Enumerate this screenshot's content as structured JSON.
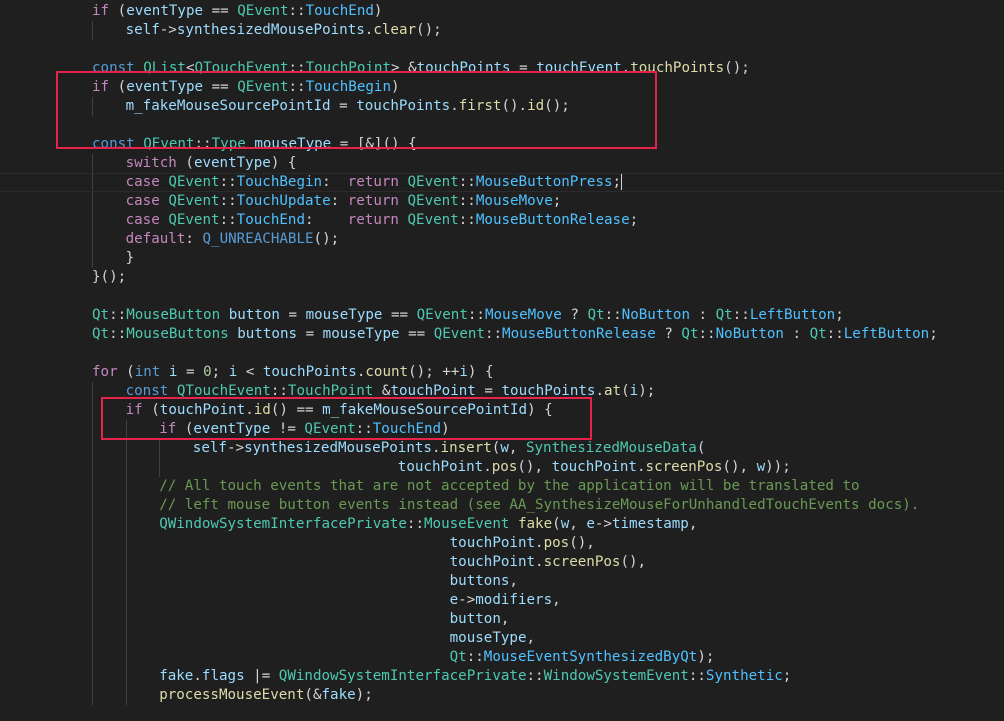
{
  "editor": {
    "lines": [
      {
        "indent": 0,
        "tokens": [
          [
            "kw",
            "if"
          ],
          [
            "op",
            " ("
          ],
          [
            "var",
            "eventType"
          ],
          [
            "op",
            " == "
          ],
          [
            "ns",
            "QEvent"
          ],
          [
            "op",
            "::"
          ],
          [
            "enum",
            "TouchEnd"
          ],
          [
            "op",
            ")"
          ]
        ]
      },
      {
        "indent": 1,
        "tokens": [
          [
            "var",
            "self"
          ],
          [
            "op",
            "->"
          ],
          [
            "var",
            "synthesizedMousePoints"
          ],
          [
            "op",
            "."
          ],
          [
            "func",
            "clear"
          ],
          [
            "op",
            "();"
          ]
        ]
      },
      {
        "indent": 0,
        "tokens": []
      },
      {
        "indent": 0,
        "tokens": [
          [
            "type",
            "const"
          ],
          [
            "op",
            " "
          ],
          [
            "ns",
            "QList"
          ],
          [
            "op",
            "<"
          ],
          [
            "ns",
            "QTouchEvent"
          ],
          [
            "op",
            "::"
          ],
          [
            "ns",
            "TouchPoint"
          ],
          [
            "op",
            "> &"
          ],
          [
            "var",
            "touchPoints"
          ],
          [
            "op",
            " = "
          ],
          [
            "var",
            "touchEvent"
          ],
          [
            "op",
            "."
          ],
          [
            "func",
            "touchPoints"
          ],
          [
            "op",
            "();"
          ]
        ]
      },
      {
        "indent": 0,
        "tokens": [
          [
            "kw",
            "if"
          ],
          [
            "op",
            " ("
          ],
          [
            "var",
            "eventType"
          ],
          [
            "op",
            " == "
          ],
          [
            "ns",
            "QEvent"
          ],
          [
            "op",
            "::"
          ],
          [
            "enum",
            "TouchBegin"
          ],
          [
            "op",
            ")"
          ]
        ]
      },
      {
        "indent": 1,
        "tokens": [
          [
            "var",
            "m_fakeMouseSourcePointId"
          ],
          [
            "op",
            " = "
          ],
          [
            "var",
            "touchPoints"
          ],
          [
            "op",
            "."
          ],
          [
            "func",
            "first"
          ],
          [
            "op",
            "()."
          ],
          [
            "func",
            "id"
          ],
          [
            "op",
            "();"
          ]
        ]
      },
      {
        "indent": 0,
        "tokens": []
      },
      {
        "indent": 0,
        "tokens": [
          [
            "type",
            "const"
          ],
          [
            "op",
            " "
          ],
          [
            "ns",
            "QEvent"
          ],
          [
            "op",
            "::"
          ],
          [
            "ns",
            "Type"
          ],
          [
            "op",
            " "
          ],
          [
            "var",
            "mouseType"
          ],
          [
            "op",
            " = [&]() {"
          ]
        ]
      },
      {
        "indent": 1,
        "tokens": [
          [
            "kw",
            "switch"
          ],
          [
            "op",
            " ("
          ],
          [
            "var",
            "eventType"
          ],
          [
            "op",
            ") {"
          ]
        ]
      },
      {
        "indent": 1,
        "current": true,
        "cursor": true,
        "tokens": [
          [
            "kw",
            "case"
          ],
          [
            "op",
            " "
          ],
          [
            "ns",
            "QEvent"
          ],
          [
            "op",
            "::"
          ],
          [
            "enum",
            "TouchBegin"
          ],
          [
            "op",
            ":  "
          ],
          [
            "kw",
            "return"
          ],
          [
            "op",
            " "
          ],
          [
            "ns",
            "QEvent"
          ],
          [
            "op",
            "::"
          ],
          [
            "enum",
            "MouseButtonPress"
          ],
          [
            "op",
            ";"
          ]
        ]
      },
      {
        "indent": 1,
        "tokens": [
          [
            "kw",
            "case"
          ],
          [
            "op",
            " "
          ],
          [
            "ns",
            "QEvent"
          ],
          [
            "op",
            "::"
          ],
          [
            "enum",
            "TouchUpdate"
          ],
          [
            "op",
            ": "
          ],
          [
            "kw",
            "return"
          ],
          [
            "op",
            " "
          ],
          [
            "ns",
            "QEvent"
          ],
          [
            "op",
            "::"
          ],
          [
            "enum",
            "MouseMove"
          ],
          [
            "op",
            ";"
          ]
        ]
      },
      {
        "indent": 1,
        "tokens": [
          [
            "kw",
            "case"
          ],
          [
            "op",
            " "
          ],
          [
            "ns",
            "QEvent"
          ],
          [
            "op",
            "::"
          ],
          [
            "enum",
            "TouchEnd"
          ],
          [
            "op",
            ":    "
          ],
          [
            "kw",
            "return"
          ],
          [
            "op",
            " "
          ],
          [
            "ns",
            "QEvent"
          ],
          [
            "op",
            "::"
          ],
          [
            "enum",
            "MouseButtonRelease"
          ],
          [
            "op",
            ";"
          ]
        ]
      },
      {
        "indent": 1,
        "tokens": [
          [
            "kw",
            "default"
          ],
          [
            "op",
            ": "
          ],
          [
            "macro",
            "Q_UNREACHABLE"
          ],
          [
            "op",
            "();"
          ]
        ]
      },
      {
        "indent": 1,
        "tokens": [
          [
            "op",
            "}"
          ]
        ]
      },
      {
        "indent": 0,
        "tokens": [
          [
            "op",
            "}();"
          ]
        ]
      },
      {
        "indent": 0,
        "tokens": []
      },
      {
        "indent": 0,
        "tokens": [
          [
            "ns",
            "Qt"
          ],
          [
            "op",
            "::"
          ],
          [
            "ns",
            "MouseButton"
          ],
          [
            "op",
            " "
          ],
          [
            "var",
            "button"
          ],
          [
            "op",
            " = "
          ],
          [
            "var",
            "mouseType"
          ],
          [
            "op",
            " == "
          ],
          [
            "ns",
            "QEvent"
          ],
          [
            "op",
            "::"
          ],
          [
            "enum",
            "MouseMove"
          ],
          [
            "op",
            " ? "
          ],
          [
            "ns",
            "Qt"
          ],
          [
            "op",
            "::"
          ],
          [
            "enum",
            "NoButton"
          ],
          [
            "op",
            " : "
          ],
          [
            "ns",
            "Qt"
          ],
          [
            "op",
            "::"
          ],
          [
            "enum",
            "LeftButton"
          ],
          [
            "op",
            ";"
          ]
        ]
      },
      {
        "indent": 0,
        "tokens": [
          [
            "ns",
            "Qt"
          ],
          [
            "op",
            "::"
          ],
          [
            "ns",
            "MouseButtons"
          ],
          [
            "op",
            " "
          ],
          [
            "var",
            "buttons"
          ],
          [
            "op",
            " = "
          ],
          [
            "var",
            "mouseType"
          ],
          [
            "op",
            " == "
          ],
          [
            "ns",
            "QEvent"
          ],
          [
            "op",
            "::"
          ],
          [
            "enum",
            "MouseButtonRelease"
          ],
          [
            "op",
            " ? "
          ],
          [
            "ns",
            "Qt"
          ],
          [
            "op",
            "::"
          ],
          [
            "enum",
            "NoButton"
          ],
          [
            "op",
            " : "
          ],
          [
            "ns",
            "Qt"
          ],
          [
            "op",
            "::"
          ],
          [
            "enum",
            "LeftButton"
          ],
          [
            "op",
            ";"
          ]
        ]
      },
      {
        "indent": 0,
        "tokens": []
      },
      {
        "indent": 0,
        "tokens": [
          [
            "kw",
            "for"
          ],
          [
            "op",
            " ("
          ],
          [
            "type",
            "int"
          ],
          [
            "op",
            " "
          ],
          [
            "var",
            "i"
          ],
          [
            "op",
            " = "
          ],
          [
            "num",
            "0"
          ],
          [
            "op",
            "; "
          ],
          [
            "var",
            "i"
          ],
          [
            "op",
            " < "
          ],
          [
            "var",
            "touchPoints"
          ],
          [
            "op",
            "."
          ],
          [
            "func",
            "count"
          ],
          [
            "op",
            "(); ++"
          ],
          [
            "var",
            "i"
          ],
          [
            "op",
            ") {"
          ]
        ]
      },
      {
        "indent": 1,
        "tokens": [
          [
            "type",
            "const"
          ],
          [
            "op",
            " "
          ],
          [
            "ns",
            "QTouchEvent"
          ],
          [
            "op",
            "::"
          ],
          [
            "ns",
            "TouchPoint"
          ],
          [
            "op",
            " &"
          ],
          [
            "var",
            "touchPoint"
          ],
          [
            "op",
            " = "
          ],
          [
            "var",
            "touchPoints"
          ],
          [
            "op",
            "."
          ],
          [
            "func",
            "at"
          ],
          [
            "op",
            "("
          ],
          [
            "var",
            "i"
          ],
          [
            "op",
            ");"
          ]
        ]
      },
      {
        "indent": 1,
        "tokens": [
          [
            "kw",
            "if"
          ],
          [
            "op",
            " ("
          ],
          [
            "var",
            "touchPoint"
          ],
          [
            "op",
            "."
          ],
          [
            "func",
            "id"
          ],
          [
            "op",
            "() == "
          ],
          [
            "var",
            "m_fakeMouseSourcePointId"
          ],
          [
            "op",
            ") {"
          ]
        ]
      },
      {
        "indent": 2,
        "tokens": [
          [
            "kw",
            "if"
          ],
          [
            "op",
            " ("
          ],
          [
            "var",
            "eventType"
          ],
          [
            "op",
            " != "
          ],
          [
            "ns",
            "QEvent"
          ],
          [
            "op",
            "::"
          ],
          [
            "enum",
            "TouchEnd"
          ],
          [
            "op",
            ")"
          ]
        ]
      },
      {
        "indent": 3,
        "tokens": [
          [
            "var",
            "self"
          ],
          [
            "op",
            "->"
          ],
          [
            "var",
            "synthesizedMousePoints"
          ],
          [
            "op",
            "."
          ],
          [
            "func",
            "insert"
          ],
          [
            "op",
            "("
          ],
          [
            "var",
            "w"
          ],
          [
            "op",
            ", "
          ],
          [
            "ns",
            "SynthesizedMouseData"
          ],
          [
            "op",
            "("
          ]
        ]
      },
      {
        "indent": 3,
        "pad": "                        ",
        "tokens": [
          [
            "var",
            "touchPoint"
          ],
          [
            "op",
            "."
          ],
          [
            "func",
            "pos"
          ],
          [
            "op",
            "(), "
          ],
          [
            "var",
            "touchPoint"
          ],
          [
            "op",
            "."
          ],
          [
            "func",
            "screenPos"
          ],
          [
            "op",
            "(), "
          ],
          [
            "var",
            "w"
          ],
          [
            "op",
            "));"
          ]
        ]
      },
      {
        "indent": 2,
        "tokens": [
          [
            "com",
            "// All touch events that are not accepted by the application will be translated to"
          ]
        ]
      },
      {
        "indent": 2,
        "tokens": [
          [
            "com",
            "// left mouse button events instead (see AA_SynthesizeMouseForUnhandledTouchEvents docs)."
          ]
        ]
      },
      {
        "indent": 2,
        "tokens": [
          [
            "ns",
            "QWindowSystemInterfacePrivate"
          ],
          [
            "op",
            "::"
          ],
          [
            "ns",
            "MouseEvent"
          ],
          [
            "op",
            " "
          ],
          [
            "func",
            "fake"
          ],
          [
            "op",
            "("
          ],
          [
            "var",
            "w"
          ],
          [
            "op",
            ", "
          ],
          [
            "var",
            "e"
          ],
          [
            "op",
            "->"
          ],
          [
            "var",
            "timestamp"
          ],
          [
            "op",
            ","
          ]
        ]
      },
      {
        "indent": 2,
        "pad": "                                  ",
        "tokens": [
          [
            "var",
            "touchPoint"
          ],
          [
            "op",
            "."
          ],
          [
            "func",
            "pos"
          ],
          [
            "op",
            "(),"
          ]
        ]
      },
      {
        "indent": 2,
        "pad": "                                  ",
        "tokens": [
          [
            "var",
            "touchPoint"
          ],
          [
            "op",
            "."
          ],
          [
            "func",
            "screenPos"
          ],
          [
            "op",
            "(),"
          ]
        ]
      },
      {
        "indent": 2,
        "pad": "                                  ",
        "tokens": [
          [
            "var",
            "buttons"
          ],
          [
            "op",
            ","
          ]
        ]
      },
      {
        "indent": 2,
        "pad": "                                  ",
        "tokens": [
          [
            "var",
            "e"
          ],
          [
            "op",
            "->"
          ],
          [
            "var",
            "modifiers"
          ],
          [
            "op",
            ","
          ]
        ]
      },
      {
        "indent": 2,
        "pad": "                                  ",
        "tokens": [
          [
            "var",
            "button"
          ],
          [
            "op",
            ","
          ]
        ]
      },
      {
        "indent": 2,
        "pad": "                                  ",
        "tokens": [
          [
            "var",
            "mouseType"
          ],
          [
            "op",
            ","
          ]
        ]
      },
      {
        "indent": 2,
        "pad": "                                  ",
        "tokens": [
          [
            "ns",
            "Qt"
          ],
          [
            "op",
            "::"
          ],
          [
            "enum",
            "MouseEventSynthesizedByQt"
          ],
          [
            "op",
            ");"
          ]
        ]
      },
      {
        "indent": 2,
        "tokens": [
          [
            "var",
            "fake"
          ],
          [
            "op",
            "."
          ],
          [
            "var",
            "flags"
          ],
          [
            "op",
            " |= "
          ],
          [
            "ns",
            "QWindowSystemInterfacePrivate"
          ],
          [
            "op",
            "::"
          ],
          [
            "ns",
            "WindowSystemEvent"
          ],
          [
            "op",
            "::"
          ],
          [
            "enum",
            "Synthetic"
          ],
          [
            "op",
            ";"
          ]
        ]
      },
      {
        "indent": 2,
        "tokens": [
          [
            "func",
            "processMouseEvent"
          ],
          [
            "op",
            "(&"
          ],
          [
            "var",
            "fake"
          ],
          [
            "op",
            ");"
          ]
        ]
      }
    ]
  }
}
